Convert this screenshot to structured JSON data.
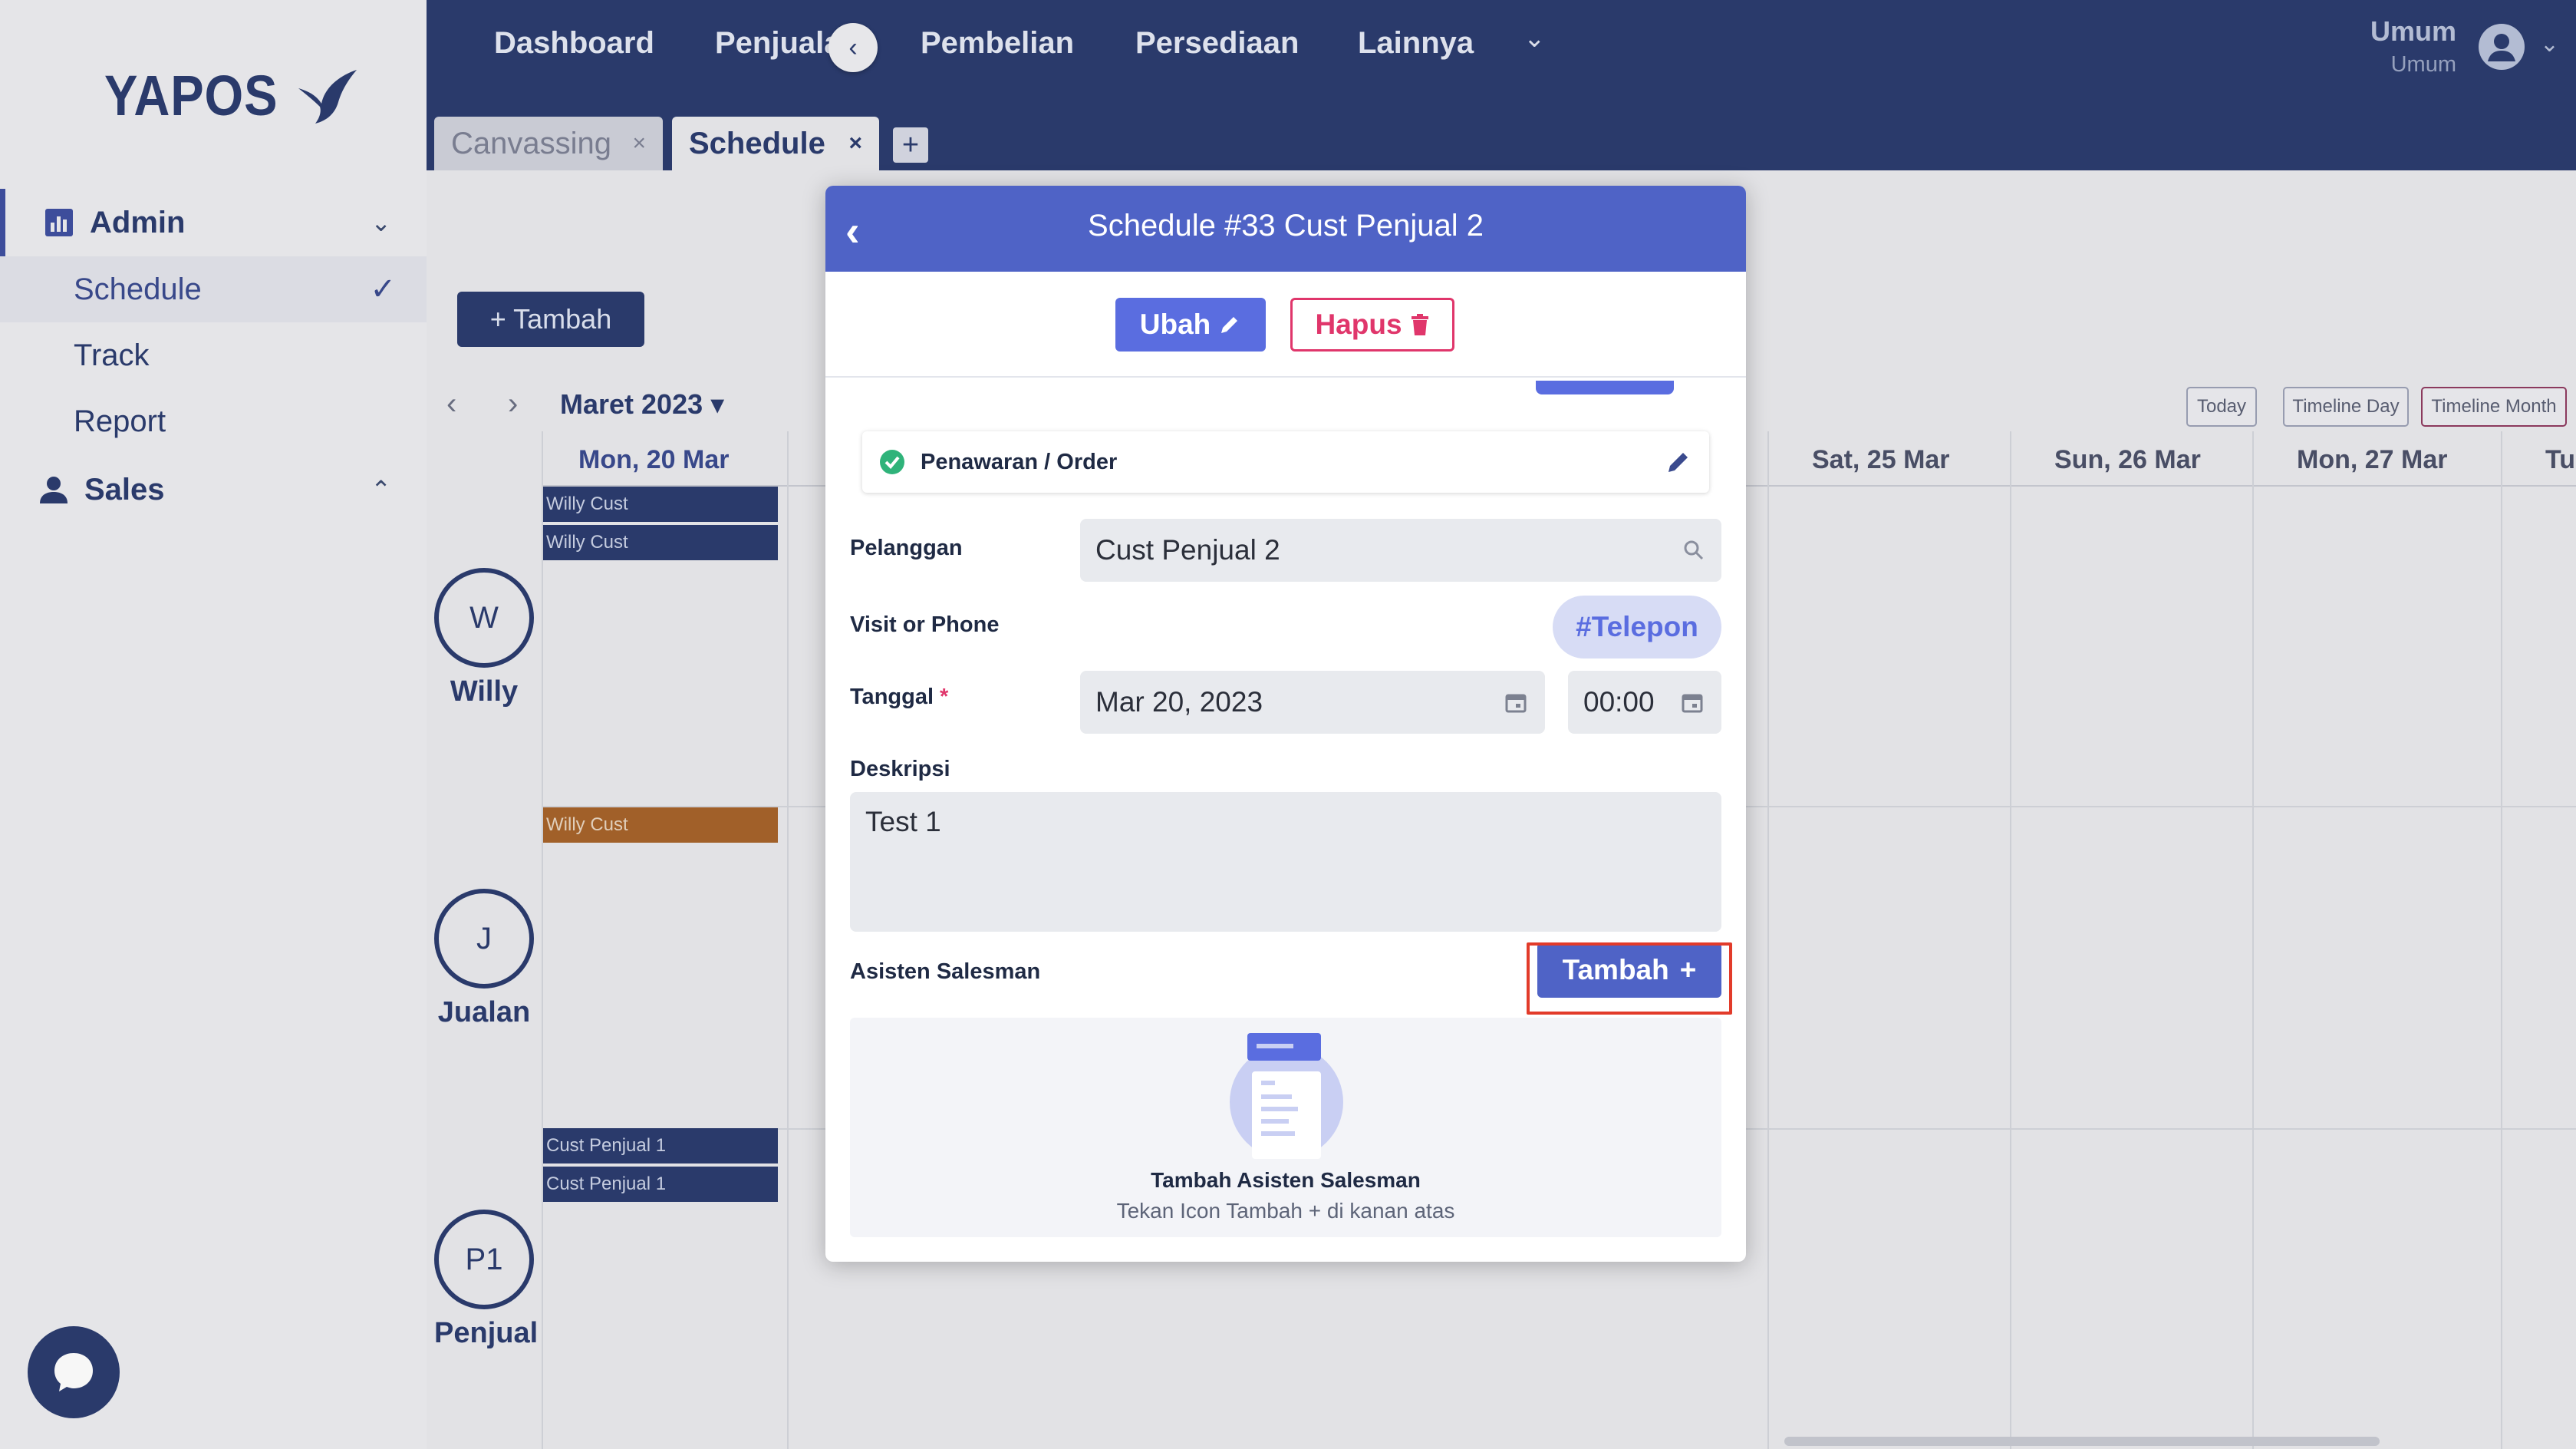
{
  "brand": {
    "logo_text": "YAPOS",
    "color": "#2b3c6e"
  },
  "sidebar": {
    "groups": [
      {
        "label": "Admin",
        "icon": "chart-icon",
        "expanded": true,
        "items": [
          {
            "label": "Schedule",
            "active": true
          },
          {
            "label": "Track"
          },
          {
            "label": "Report"
          }
        ]
      },
      {
        "label": "Sales",
        "icon": "person-icon",
        "expanded": true
      }
    ]
  },
  "topnav": {
    "items": [
      "Dashboard",
      "Penjualan",
      "Pembelian",
      "Persediaan",
      "Lainnya"
    ],
    "user": {
      "name": "Umum",
      "role": "Umum"
    }
  },
  "tabs": [
    {
      "label": "Canvassing",
      "active": false
    },
    {
      "label": "Schedule",
      "active": true
    }
  ],
  "tab_add": "+",
  "calendar": {
    "add_button": "+ Tambah",
    "month": "Maret 2023",
    "views": [
      "Today",
      "Timeline Day",
      "Timeline Month"
    ],
    "days": [
      "Mon, 20 Mar",
      "Sat, 25 Mar",
      "Sun, 26 Mar",
      "Mon, 27 Mar",
      "Tu"
    ],
    "people": [
      {
        "initial": "W",
        "name": "Willy",
        "events": [
          "Willy Cust",
          "Willy Cust"
        ]
      },
      {
        "initial": "J",
        "name": "Jualan",
        "events": [
          "Willy Cust"
        ]
      },
      {
        "initial": "P1",
        "name": "Penjual",
        "events": [
          "Cust Penjual 1",
          "Cust Penjual 1"
        ]
      }
    ]
  },
  "modal": {
    "title": "Schedule #33 Cust Penjual 2",
    "edit_button": "Ubah",
    "delete_button": "Hapus",
    "status": "Penawaran / Order",
    "fields": {
      "pelanggan": {
        "label": "Pelanggan",
        "value": "Cust Penjual 2"
      },
      "visit": {
        "label": "Visit or Phone",
        "value": "#Telepon"
      },
      "tanggal": {
        "label": "Tanggal",
        "required": "*",
        "date": "Mar 20, 2023",
        "time": "00:00"
      },
      "deskripsi": {
        "label": "Deskripsi",
        "value": "Test 1"
      }
    },
    "asisten": {
      "label": "Asisten Salesman",
      "add_button": "Tambah",
      "add_symbol": "+",
      "empty_title": "Tambah Asisten Salesman",
      "empty_subtitle": "Tekan Icon Tambah + di kanan atas"
    }
  },
  "colors": {
    "primary": "#4f63c6",
    "danger": "#e0366b",
    "navy": "#2b3c6e",
    "highlight": "#e23b2a"
  }
}
